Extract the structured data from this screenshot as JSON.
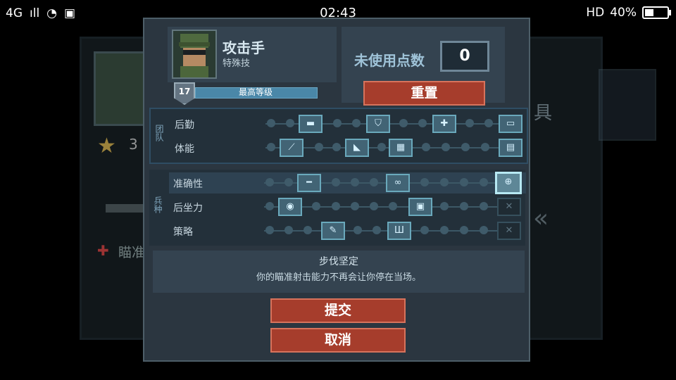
{
  "status_bar": {
    "network": "4G",
    "time": "02:43",
    "hd": "HD",
    "battery": "40%",
    "battery_level": 0.4
  },
  "background": {
    "star_count": "3",
    "aim_label": "瞄准",
    "right_label": "具"
  },
  "hero": {
    "name": "攻击手",
    "subtitle": "特殊技",
    "level": "17",
    "level_text": "最高等级"
  },
  "points": {
    "label": "未使用点数",
    "value": "0",
    "reset_label": "重置"
  },
  "sections": {
    "team": {
      "label": "团队",
      "rows": [
        {
          "label": "后勤"
        },
        {
          "label": "体能"
        }
      ]
    },
    "arms": {
      "label": "兵种",
      "rows": [
        {
          "label": "准确性"
        },
        {
          "label": "后坐力"
        },
        {
          "label": "策略"
        }
      ]
    }
  },
  "description": {
    "title": "步伐坚定",
    "body": "你的瞄准射击能力不再会让你停在当场。"
  },
  "buttons": {
    "submit": "提交",
    "cancel": "取消"
  },
  "colors": {
    "dialog_bg": "#2b3640",
    "button_red": "#a63d2c",
    "node_active": "#426475",
    "node_border": "#6aa9bc"
  }
}
